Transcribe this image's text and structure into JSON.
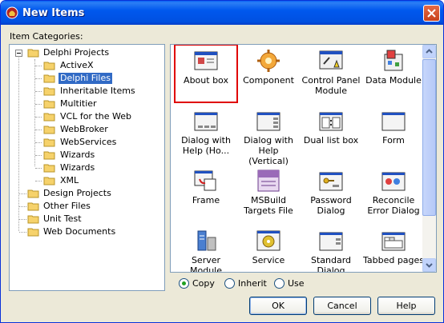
{
  "window": {
    "title": "New Items"
  },
  "categories": {
    "label": "Item Categories:",
    "tree": [
      {
        "label": "Delphi Projects",
        "level": 0,
        "expanded": true
      },
      {
        "label": "ActiveX",
        "level": 1
      },
      {
        "label": "Delphi Files",
        "level": 1,
        "selected": true
      },
      {
        "label": "Inheritable Items",
        "level": 1
      },
      {
        "label": "Multitier",
        "level": 1
      },
      {
        "label": "VCL for the Web",
        "level": 1
      },
      {
        "label": "WebBroker",
        "level": 1
      },
      {
        "label": "WebServices",
        "level": 1
      },
      {
        "label": "Wizards",
        "level": 1
      },
      {
        "label": "Wizards",
        "level": 1
      },
      {
        "label": "XML",
        "level": 1
      },
      {
        "label": "Design Projects",
        "level": 0
      },
      {
        "label": "Other Files",
        "level": 0
      },
      {
        "label": "Unit Test",
        "level": 0
      },
      {
        "label": "Web Documents",
        "level": 0
      }
    ]
  },
  "items": [
    {
      "label": "About box",
      "icon": "about-box-icon",
      "highlighted": true
    },
    {
      "label": "Component",
      "icon": "component-gear-icon"
    },
    {
      "label": "Control Panel Module",
      "icon": "control-panel-icon"
    },
    {
      "label": "Data Module",
      "icon": "data-module-icon"
    },
    {
      "label": "Dialog with Help (Ho...",
      "icon": "dialog-help-horizontal-icon"
    },
    {
      "label": "Dialog with Help (Vertical)",
      "icon": "dialog-help-vertical-icon"
    },
    {
      "label": "Dual list box",
      "icon": "dual-list-box-icon"
    },
    {
      "label": "Form",
      "icon": "form-icon"
    },
    {
      "label": "Frame",
      "icon": "frame-icon"
    },
    {
      "label": "MSBuild Targets File",
      "icon": "xml-file-icon"
    },
    {
      "label": "Password Dialog",
      "icon": "password-dialog-icon"
    },
    {
      "label": "Reconcile Error Dialog",
      "icon": "reconcile-dialog-icon"
    },
    {
      "label": "Server Module",
      "icon": "server-module-icon"
    },
    {
      "label": "Service",
      "icon": "service-icon"
    },
    {
      "label": "Standard Dialog",
      "icon": "standard-dialog-icon"
    },
    {
      "label": "Tabbed pages",
      "icon": "tabbed-pages-icon"
    }
  ],
  "options": {
    "copy": "Copy",
    "inherit": "Inherit",
    "use": "Use",
    "selected": "copy"
  },
  "buttons": {
    "ok": "OK",
    "cancel": "Cancel",
    "help": "Help"
  },
  "colors": {
    "selection": "#316ac5",
    "highlight_box": "#e00000",
    "titlebar": "#0058ee"
  }
}
